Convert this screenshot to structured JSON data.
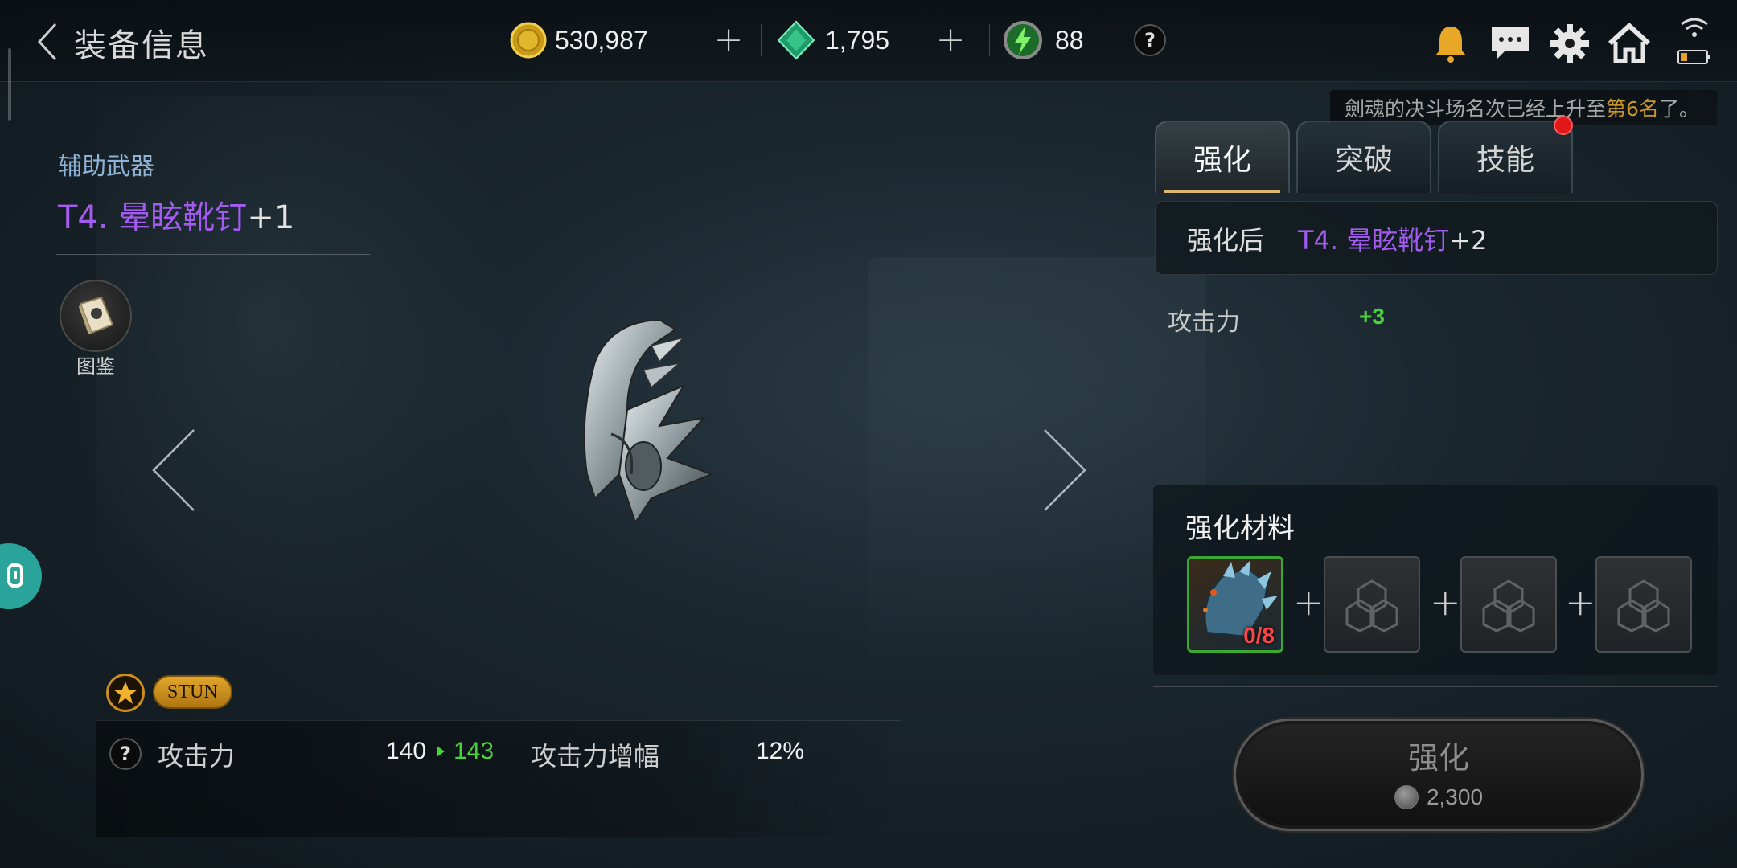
{
  "header": {
    "title": "装备信息",
    "gold": "530,987",
    "gems": "1,795",
    "energy": "88",
    "help": "?"
  },
  "notice": {
    "name": "劍魂",
    "middle": "的决斗场名次已经上升至",
    "rank": "第6名",
    "end": "了。"
  },
  "item": {
    "category": "辅助武器",
    "name": "T4. 晕眩靴钉",
    "level": "+1",
    "codex_label": "图鉴",
    "tag": "STUN"
  },
  "stats": {
    "help": "?",
    "atk_label": "攻击力",
    "atk_from": "140",
    "atk_to": "143",
    "atk_amp_label": "攻击力增幅",
    "atk_amp_val": "12%"
  },
  "tabs": [
    {
      "label": "强化",
      "active": true
    },
    {
      "label": "突破",
      "active": false
    },
    {
      "label": "技能",
      "active": false
    }
  ],
  "enhance": {
    "after_label": "强化后",
    "after_name": "T4. 晕眩靴钉",
    "after_level": "+2",
    "bonus_label": "攻击力",
    "bonus_val": "+3",
    "materials_title": "强化材料",
    "material_count": "0/8",
    "button_label": "强化",
    "cost": "2,300"
  },
  "colors": {
    "item_purple": "#a35cf0",
    "stat_green": "#49d33a",
    "gold_accent": "#c9962d"
  }
}
